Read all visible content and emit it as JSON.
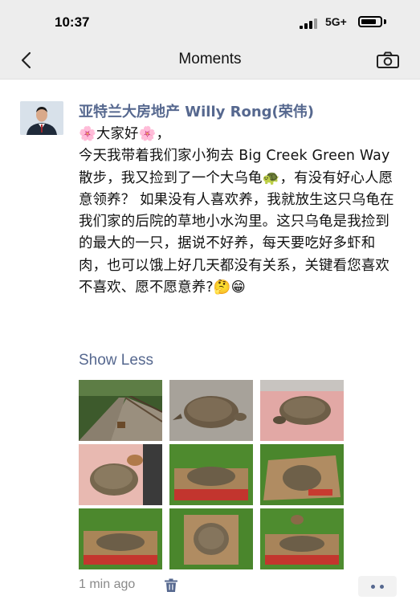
{
  "status_bar": {
    "time": "10:37",
    "network": "5G+"
  },
  "nav": {
    "title": "Moments"
  },
  "post": {
    "author": "亚特兰大房地产 Willy Rong(荣伟)",
    "text": "🌸大家好🌸，\n今天我带着我们家小狗去 Big Creek Green Way 散步，我又捡到了一个大乌龟🐢，有没有好心人愿意领养？ 如果没有人喜欢养，我就放生这只乌龟在我们家的后院的草地小水沟里。这只乌龟是我捡到的最大的一只，据说不好养，每天要吃好多虾和肉，也可以饿上好几天都没有关系，关键看您喜欢不喜欢、愿不愿意养?🤔😁",
    "show_less": "Show Less",
    "timestamp": "1 min ago"
  },
  "icons": {
    "back": "chevron-left-icon",
    "camera": "camera-icon",
    "trash": "trash-icon",
    "comment": "more-dots-icon"
  },
  "colors": {
    "link": "#56688f",
    "nav_bg": "#ededed",
    "timestamp": "#8a8a8a"
  }
}
